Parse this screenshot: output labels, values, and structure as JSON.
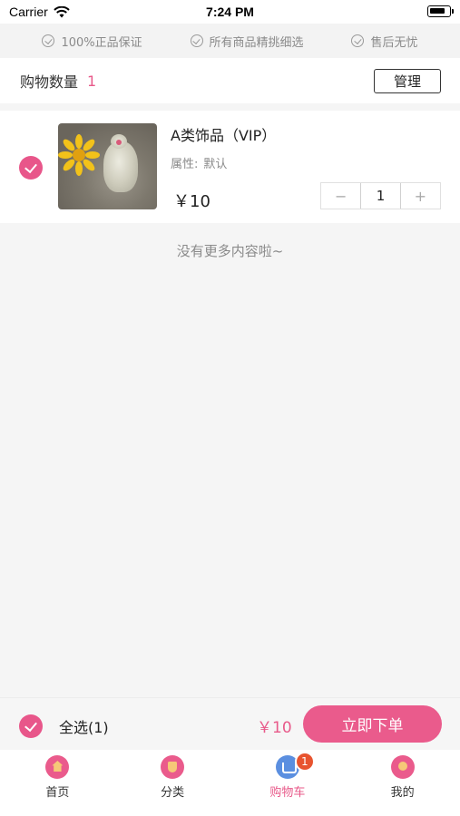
{
  "status_bar": {
    "carrier": "Carrier",
    "time": "7:24 PM"
  },
  "guarantees": [
    {
      "label": "100%正品保证"
    },
    {
      "label": "所有商品精挑细选"
    },
    {
      "label": "售后无忧"
    }
  ],
  "cart_header": {
    "title": "购物数量",
    "count": "1",
    "manage_label": "管理"
  },
  "item": {
    "name": "A类饰品（VIP）",
    "attr_label": "属性:",
    "attr_value": "默认",
    "price": "￥10",
    "quantity": "1",
    "minus": "−",
    "plus": "+",
    "selected": true
  },
  "no_more_text": "没有更多内容啦~",
  "checkout": {
    "select_all_label": "全选(1)",
    "total": "￥10",
    "order_label": "立即下单"
  },
  "tabs": [
    {
      "label": "首页",
      "icon": "home-icon"
    },
    {
      "label": "分类",
      "icon": "category-icon"
    },
    {
      "label": "购物车",
      "icon": "cart-icon",
      "active": true,
      "badge": "1"
    },
    {
      "label": "我的",
      "icon": "profile-icon"
    }
  ],
  "colors": {
    "accent": "#e8568a",
    "badge": "#e8542f"
  }
}
